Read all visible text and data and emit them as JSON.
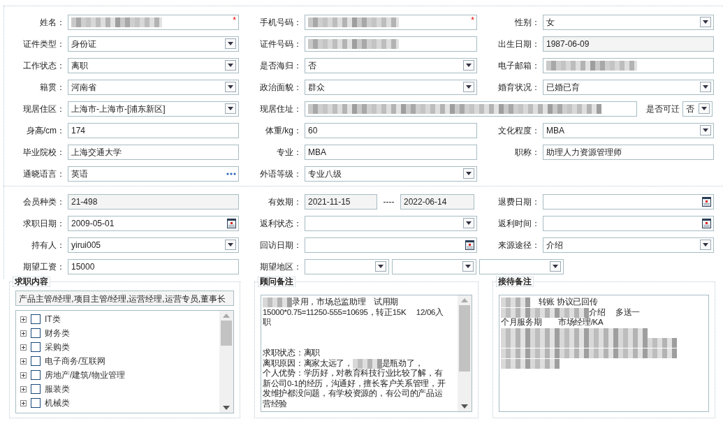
{
  "sections": [
    {
      "rows": [
        [
          {
            "label": "姓名：",
            "kind": "text",
            "redacted": true,
            "required_mark": "*"
          },
          {
            "label": "手机号码：",
            "kind": "text",
            "redacted": true,
            "required_mark": "*"
          },
          {
            "label": "性别：",
            "kind": "select",
            "value": "女"
          }
        ],
        [
          {
            "label": "证件类型：",
            "kind": "select",
            "value": "身份证"
          },
          {
            "label": "证件号码：",
            "kind": "text",
            "redacted": true
          },
          {
            "label": "出生日期：",
            "kind": "readonly",
            "value": "1987-06-09"
          }
        ],
        [
          {
            "label": "工作状态：",
            "kind": "select",
            "value": "离职"
          },
          {
            "label": "是否海归：",
            "kind": "select",
            "value": "否"
          },
          {
            "label": "电子邮箱：",
            "kind": "text",
            "redacted": true
          }
        ],
        [
          {
            "label": "籍贯：",
            "kind": "select",
            "value": "河南省"
          },
          {
            "label": "政治面貌：",
            "kind": "select",
            "value": "群众"
          },
          {
            "label": "婚育状况：",
            "kind": "select",
            "value": "已婚已育"
          }
        ],
        [
          {
            "label": "现居住区：",
            "kind": "select",
            "value": "上海市-上海市-[浦东新区]"
          },
          {
            "label": "现居住址：",
            "kind": "text",
            "redacted": true,
            "inline_field": {
              "label": "是否可迁",
              "kind": "select",
              "value": "否"
            }
          }
        ],
        [
          {
            "label": "身高/cm：",
            "kind": "text",
            "value": "174"
          },
          {
            "label": "体重/kg：",
            "kind": "text",
            "value": "60"
          },
          {
            "label": "文化程度：",
            "kind": "select",
            "value": "MBA"
          }
        ],
        [
          {
            "label": "毕业院校：",
            "kind": "text",
            "value": "上海交通大学"
          },
          {
            "label": "专业：",
            "kind": "text",
            "value": "MBA"
          },
          {
            "label": "职称：",
            "kind": "text",
            "value": "助理人力资源管理师"
          }
        ],
        [
          {
            "label": "通晓语言：",
            "kind": "more",
            "value": "英语"
          },
          {
            "label": "外语等级：",
            "kind": "select",
            "value": "专业八级"
          }
        ]
      ]
    },
    {
      "rows": [
        [
          {
            "label": "会员种类：",
            "kind": "readonly",
            "value": "21-498"
          },
          {
            "label": "有效期：",
            "kind": "range",
            "from": "2021-11-15",
            "separator": "----",
            "to": "2022-06-14"
          },
          {
            "label": "退费日期：",
            "kind": "date"
          }
        ],
        [
          {
            "label": "求职日期：",
            "kind": "date",
            "value": "2009-05-01"
          },
          {
            "label": "返利状态：",
            "kind": "select"
          },
          {
            "label": "返利时间：",
            "kind": "date"
          }
        ],
        [
          {
            "label": "持有人：",
            "kind": "select",
            "value": "yirui005"
          },
          {
            "label": "回访日期：",
            "kind": "date"
          },
          {
            "label": "来源途径：",
            "kind": "select",
            "value": "介绍"
          }
        ],
        [
          {
            "label": "期望工资：",
            "kind": "text",
            "value": "15000"
          },
          {
            "label": "期望地区：",
            "kind": "select_group",
            "parts": [
              {
                "kind": "select"
              },
              {
                "kind": "select"
              },
              {
                "kind": "select"
              }
            ]
          }
        ]
      ]
    }
  ],
  "panels": [
    {
      "title": "求职内容",
      "kind": "tree",
      "selection": "产品主管/经理,项目主管/经理,运营经理,运营专员,董事长",
      "items": [
        {
          "label": "IT类",
          "expanded": false,
          "checked": false
        },
        {
          "label": "财务类",
          "expanded": false,
          "checked": false
        },
        {
          "label": "采购类",
          "expanded": false,
          "checked": false
        },
        {
          "label": "电子商务/互联网",
          "expanded": false,
          "checked": false
        },
        {
          "label": "房地产/建筑/物业管理",
          "expanded": false,
          "checked": false
        },
        {
          "label": "服装类",
          "expanded": false,
          "checked": false
        },
        {
          "label": "机械类",
          "expanded": false,
          "checked": false
        }
      ]
    },
    {
      "title": "顾问备注",
      "kind": "notes",
      "scrollable": true,
      "lines": [
        {
          "kind": "text",
          "segments": [
            {
              "kind": "blur"
            },
            {
              "kind": "text",
              "text": "录用，市场总监助理　试用期"
            }
          ]
        },
        {
          "kind": "text",
          "segments": [
            {
              "kind": "text",
              "text": "15000*0.75=11250-555=10695，转正15K　 12/06入"
            }
          ]
        },
        {
          "kind": "text",
          "segments": [
            {
              "kind": "text",
              "text": "职"
            }
          ]
        },
        {
          "kind": "blank"
        },
        {
          "kind": "blank"
        },
        {
          "kind": "text",
          "segments": [
            {
              "kind": "text",
              "text": "求职状态：离职"
            }
          ]
        },
        {
          "kind": "text",
          "segments": [
            {
              "kind": "text",
              "text": "离职原因：离家太远了，"
            },
            {
              "kind": "blur"
            },
            {
              "kind": "text",
              "text": "是瓶劲了，"
            }
          ]
        },
        {
          "kind": "text",
          "segments": [
            {
              "kind": "text",
              "text": "个人优势：学历好，对教育科技行业比较了解，有"
            }
          ]
        },
        {
          "kind": "text",
          "segments": [
            {
              "kind": "text",
              "text": "新公司0-1的经历，沟通好，擅长客户关系管理，开"
            }
          ]
        },
        {
          "kind": "text",
          "segments": [
            {
              "kind": "text",
              "text": "发维护都没问题，有学校资源的，有公司的产品运"
            }
          ]
        },
        {
          "kind": "text",
          "segments": [
            {
              "kind": "text",
              "text": "营经验"
            }
          ]
        }
      ]
    },
    {
      "title": "接待备注",
      "kind": "notes",
      "scrollable": false,
      "lines": [
        {
          "kind": "text",
          "segments": [
            {
              "kind": "blur"
            },
            {
              "kind": "text",
              "text": "　转账 协议已回传"
            }
          ]
        },
        {
          "kind": "text",
          "segments": [
            {
              "kind": "blur"
            },
            {
              "kind": "blur"
            },
            {
              "kind": "blur"
            },
            {
              "kind": "text",
              "text": "介绍　 多送一"
            }
          ]
        },
        {
          "kind": "text",
          "segments": [
            {
              "kind": "text",
              "text": "个月服务期　　市场经理/KA"
            }
          ]
        },
        {
          "kind": "text",
          "segments": [
            {
              "kind": "blur"
            },
            {
              "kind": "blur"
            },
            {
              "kind": "blur"
            },
            {
              "kind": "blur"
            },
            {
              "kind": "blur"
            }
          ]
        },
        {
          "kind": "text",
          "segments": [
            {
              "kind": "blur"
            },
            {
              "kind": "blur"
            },
            {
              "kind": "blur"
            },
            {
              "kind": "blur"
            },
            {
              "kind": "blur"
            },
            {
              "kind": "blur"
            }
          ]
        },
        {
          "kind": "text",
          "segments": [
            {
              "kind": "blur"
            },
            {
              "kind": "blur"
            },
            {
              "kind": "blur"
            },
            {
              "kind": "blur"
            },
            {
              "kind": "blur"
            },
            {
              "kind": "blur"
            }
          ]
        },
        {
          "kind": "text",
          "segments": [
            {
              "kind": "blur"
            },
            {
              "kind": "blur"
            }
          ]
        }
      ]
    }
  ]
}
